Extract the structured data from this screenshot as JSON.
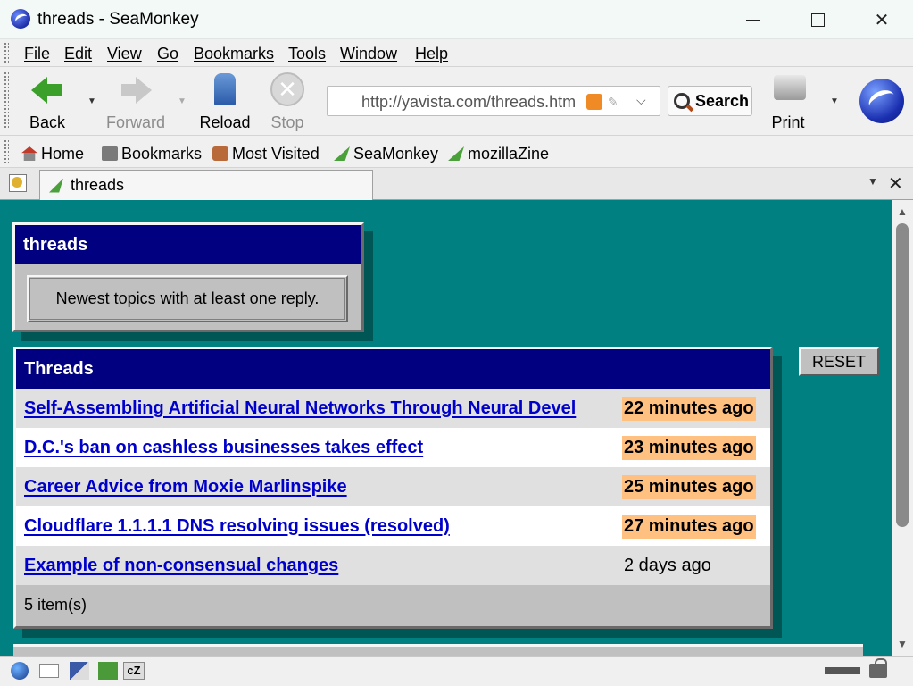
{
  "window": {
    "title": "threads - SeaMonkey"
  },
  "menu": [
    "File",
    "Edit",
    "View",
    "Go",
    "Bookmarks",
    "Tools",
    "Window",
    "Help"
  ],
  "toolbar": {
    "back": "Back",
    "forward": "Forward",
    "reload": "Reload",
    "stop": "Stop",
    "url": "http://yavista.com/threads.htm",
    "search": "Search",
    "print": "Print"
  },
  "personal_bar": [
    "Home",
    "Bookmarks",
    "Most Visited",
    "SeaMonkey",
    "mozillaZine"
  ],
  "tab": {
    "title": "threads"
  },
  "page": {
    "panel1": {
      "title": "threads",
      "description": "Newest topics with at least one reply."
    },
    "panel2": {
      "title": "Threads",
      "rows": [
        {
          "title": "Self-Assembling Artificial Neural Networks Through Neural Devel",
          "time": "22 minutes ago",
          "hot": true
        },
        {
          "title": "D.C.'s ban on cashless businesses takes effect",
          "time": "23 minutes ago",
          "hot": true
        },
        {
          "title": "Career Advice from Moxie Marlinspike",
          "time": "25 minutes ago",
          "hot": true
        },
        {
          "title": "Cloudflare 1.1.1.1 DNS resolving issues (resolved)",
          "time": "27 minutes ago",
          "hot": true
        },
        {
          "title": "Example of non-consensual changes",
          "time": "2 days ago",
          "hot": false
        }
      ],
      "footer": "5 item(s)"
    },
    "reset_label": "RESET"
  },
  "colors": {
    "page_background": "#008080",
    "panel_header": "#000080",
    "link": "#0000cc",
    "hot_time": "#ffc080"
  }
}
